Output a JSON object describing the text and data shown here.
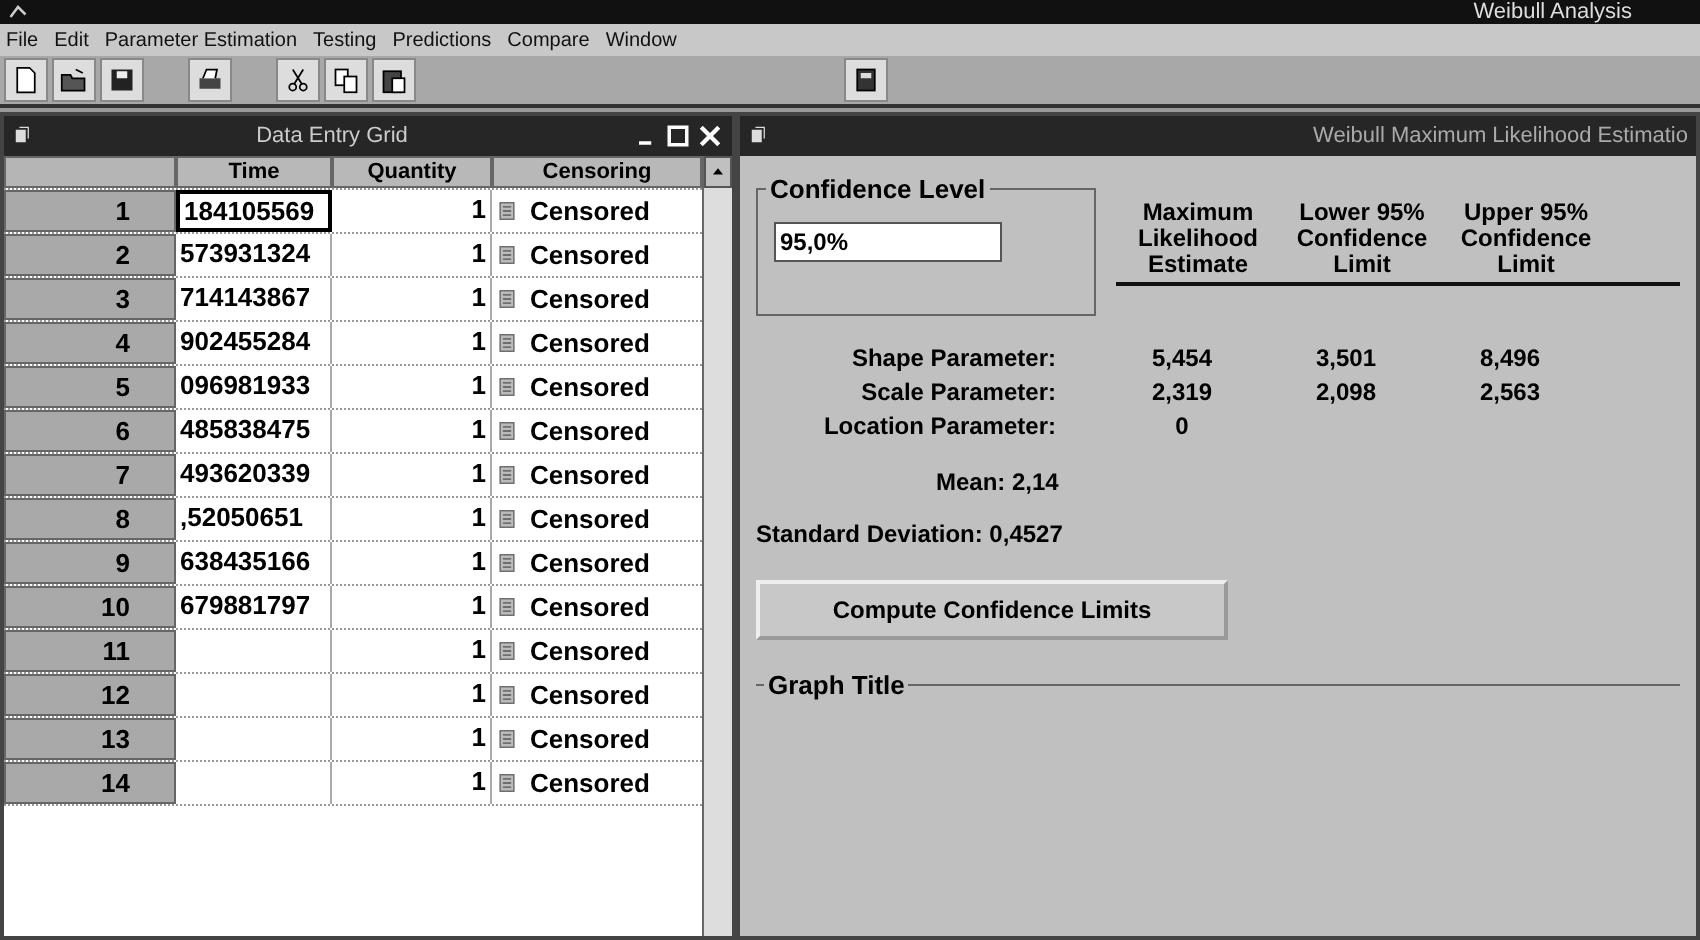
{
  "window": {
    "title": "Weibull Analysis"
  },
  "menu": [
    "File",
    "Edit",
    "Parameter Estimation",
    "Testing",
    "Predictions",
    "Compare",
    "Window"
  ],
  "grid_window": {
    "title": "Data Entry Grid",
    "columns": [
      "Time",
      "Quantity",
      "Censoring"
    ],
    "rows": [
      {
        "number": "1",
        "time": "184105569",
        "quantity": "1",
        "censoring": "Censored",
        "selected": true
      },
      {
        "number": "2",
        "time": "573931324",
        "quantity": "1",
        "censoring": "Censored",
        "selected": false
      },
      {
        "number": "3",
        "time": "714143867",
        "quantity": "1",
        "censoring": "Censored",
        "selected": false
      },
      {
        "number": "4",
        "time": "902455284",
        "quantity": "1",
        "censoring": "Censored",
        "selected": false
      },
      {
        "number": "5",
        "time": "096981933",
        "quantity": "1",
        "censoring": "Censored",
        "selected": false
      },
      {
        "number": "6",
        "time": "485838475",
        "quantity": "1",
        "censoring": "Censored",
        "selected": false
      },
      {
        "number": "7",
        "time": "493620339",
        "quantity": "1",
        "censoring": "Censored",
        "selected": false
      },
      {
        "number": "8",
        "time": ",52050651",
        "quantity": "1",
        "censoring": "Censored",
        "selected": false
      },
      {
        "number": "9",
        "time": "638435166",
        "quantity": "1",
        "censoring": "Censored",
        "selected": false
      },
      {
        "number": "10",
        "time": "679881797",
        "quantity": "1",
        "censoring": "Censored",
        "selected": false
      },
      {
        "number": "11",
        "quantity": "1",
        "censoring": "Censored",
        "selected": false
      },
      {
        "number": "12",
        "quantity": "1",
        "censoring": "Censored",
        "selected": false
      },
      {
        "number": "13",
        "quantity": "1",
        "censoring": "Censored",
        "selected": false
      },
      {
        "number": "14",
        "quantity": "1",
        "censoring": "Censored",
        "selected": false
      }
    ]
  },
  "estimate_window": {
    "title": "Weibull Maximum Likelihood Estimatio",
    "confidence_label": "Confidence Level",
    "confidence_value": "95,0%",
    "headers": [
      "Maximum Likelihood Estimate",
      "Lower 95% Confidence Limit",
      "Upper 95% Confidence Limit"
    ],
    "parameters": [
      {
        "label": "Shape Parameter:",
        "values": [
          "5,454",
          "3,501",
          "8,496"
        ]
      },
      {
        "label": "Scale Parameter:",
        "values": [
          "2,319",
          "2,098",
          "2,563"
        ]
      },
      {
        "label": "Location Parameter:",
        "values": [
          "0"
        ]
      }
    ],
    "mean": "Mean: 2,14",
    "std_dev": "Standard Deviation: 0,4527",
    "button": "Compute Confidence Limits",
    "graph_title_label": "Graph Title"
  }
}
